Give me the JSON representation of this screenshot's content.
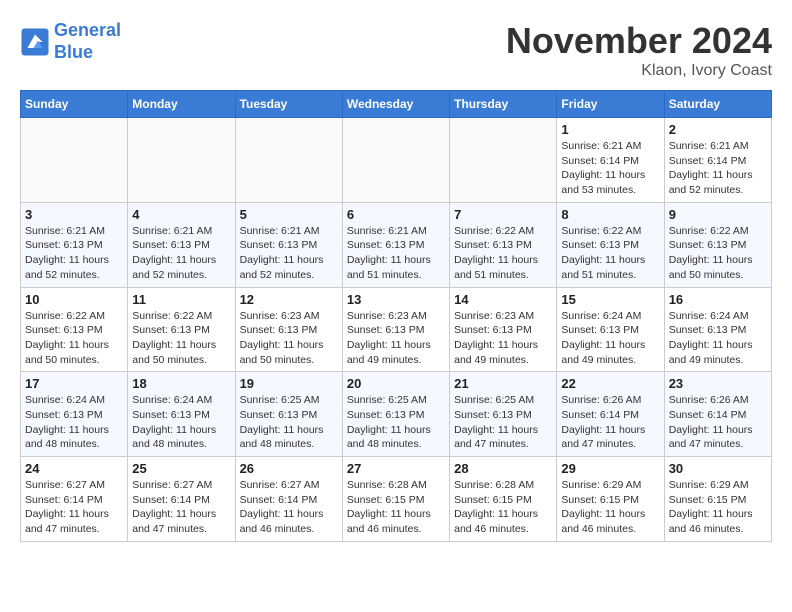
{
  "header": {
    "logo_line1": "General",
    "logo_line2": "Blue",
    "month_title": "November 2024",
    "location": "Klaon, Ivory Coast"
  },
  "days_of_week": [
    "Sunday",
    "Monday",
    "Tuesday",
    "Wednesday",
    "Thursday",
    "Friday",
    "Saturday"
  ],
  "weeks": [
    [
      {
        "num": "",
        "info": ""
      },
      {
        "num": "",
        "info": ""
      },
      {
        "num": "",
        "info": ""
      },
      {
        "num": "",
        "info": ""
      },
      {
        "num": "",
        "info": ""
      },
      {
        "num": "1",
        "info": "Sunrise: 6:21 AM\nSunset: 6:14 PM\nDaylight: 11 hours\nand 53 minutes."
      },
      {
        "num": "2",
        "info": "Sunrise: 6:21 AM\nSunset: 6:14 PM\nDaylight: 11 hours\nand 52 minutes."
      }
    ],
    [
      {
        "num": "3",
        "info": "Sunrise: 6:21 AM\nSunset: 6:13 PM\nDaylight: 11 hours\nand 52 minutes."
      },
      {
        "num": "4",
        "info": "Sunrise: 6:21 AM\nSunset: 6:13 PM\nDaylight: 11 hours\nand 52 minutes."
      },
      {
        "num": "5",
        "info": "Sunrise: 6:21 AM\nSunset: 6:13 PM\nDaylight: 11 hours\nand 52 minutes."
      },
      {
        "num": "6",
        "info": "Sunrise: 6:21 AM\nSunset: 6:13 PM\nDaylight: 11 hours\nand 51 minutes."
      },
      {
        "num": "7",
        "info": "Sunrise: 6:22 AM\nSunset: 6:13 PM\nDaylight: 11 hours\nand 51 minutes."
      },
      {
        "num": "8",
        "info": "Sunrise: 6:22 AM\nSunset: 6:13 PM\nDaylight: 11 hours\nand 51 minutes."
      },
      {
        "num": "9",
        "info": "Sunrise: 6:22 AM\nSunset: 6:13 PM\nDaylight: 11 hours\nand 50 minutes."
      }
    ],
    [
      {
        "num": "10",
        "info": "Sunrise: 6:22 AM\nSunset: 6:13 PM\nDaylight: 11 hours\nand 50 minutes."
      },
      {
        "num": "11",
        "info": "Sunrise: 6:22 AM\nSunset: 6:13 PM\nDaylight: 11 hours\nand 50 minutes."
      },
      {
        "num": "12",
        "info": "Sunrise: 6:23 AM\nSunset: 6:13 PM\nDaylight: 11 hours\nand 50 minutes."
      },
      {
        "num": "13",
        "info": "Sunrise: 6:23 AM\nSunset: 6:13 PM\nDaylight: 11 hours\nand 49 minutes."
      },
      {
        "num": "14",
        "info": "Sunrise: 6:23 AM\nSunset: 6:13 PM\nDaylight: 11 hours\nand 49 minutes."
      },
      {
        "num": "15",
        "info": "Sunrise: 6:24 AM\nSunset: 6:13 PM\nDaylight: 11 hours\nand 49 minutes."
      },
      {
        "num": "16",
        "info": "Sunrise: 6:24 AM\nSunset: 6:13 PM\nDaylight: 11 hours\nand 49 minutes."
      }
    ],
    [
      {
        "num": "17",
        "info": "Sunrise: 6:24 AM\nSunset: 6:13 PM\nDaylight: 11 hours\nand 48 minutes."
      },
      {
        "num": "18",
        "info": "Sunrise: 6:24 AM\nSunset: 6:13 PM\nDaylight: 11 hours\nand 48 minutes."
      },
      {
        "num": "19",
        "info": "Sunrise: 6:25 AM\nSunset: 6:13 PM\nDaylight: 11 hours\nand 48 minutes."
      },
      {
        "num": "20",
        "info": "Sunrise: 6:25 AM\nSunset: 6:13 PM\nDaylight: 11 hours\nand 48 minutes."
      },
      {
        "num": "21",
        "info": "Sunrise: 6:25 AM\nSunset: 6:13 PM\nDaylight: 11 hours\nand 47 minutes."
      },
      {
        "num": "22",
        "info": "Sunrise: 6:26 AM\nSunset: 6:14 PM\nDaylight: 11 hours\nand 47 minutes."
      },
      {
        "num": "23",
        "info": "Sunrise: 6:26 AM\nSunset: 6:14 PM\nDaylight: 11 hours\nand 47 minutes."
      }
    ],
    [
      {
        "num": "24",
        "info": "Sunrise: 6:27 AM\nSunset: 6:14 PM\nDaylight: 11 hours\nand 47 minutes."
      },
      {
        "num": "25",
        "info": "Sunrise: 6:27 AM\nSunset: 6:14 PM\nDaylight: 11 hours\nand 47 minutes."
      },
      {
        "num": "26",
        "info": "Sunrise: 6:27 AM\nSunset: 6:14 PM\nDaylight: 11 hours\nand 46 minutes."
      },
      {
        "num": "27",
        "info": "Sunrise: 6:28 AM\nSunset: 6:15 PM\nDaylight: 11 hours\nand 46 minutes."
      },
      {
        "num": "28",
        "info": "Sunrise: 6:28 AM\nSunset: 6:15 PM\nDaylight: 11 hours\nand 46 minutes."
      },
      {
        "num": "29",
        "info": "Sunrise: 6:29 AM\nSunset: 6:15 PM\nDaylight: 11 hours\nand 46 minutes."
      },
      {
        "num": "30",
        "info": "Sunrise: 6:29 AM\nSunset: 6:15 PM\nDaylight: 11 hours\nand 46 minutes."
      }
    ]
  ]
}
